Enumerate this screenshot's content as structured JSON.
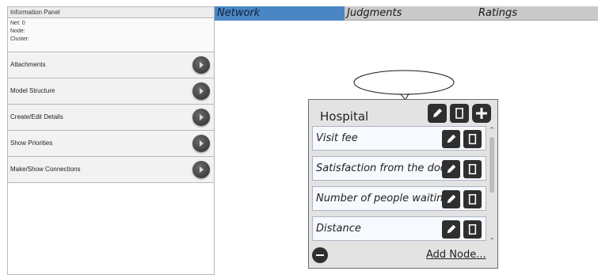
{
  "info_panel": {
    "title": "Information Panel",
    "net_line": "Net: 0",
    "node_line": "Node:",
    "cluster_line": "Cluster:",
    "buttons": [
      {
        "label": "Attachments",
        "icon": "chevron-right-icon"
      },
      {
        "label": "Model Structure",
        "icon": "chevron-right-icon"
      },
      {
        "label": "Create/Edit Details",
        "icon": "chevron-right-icon"
      },
      {
        "label": "Show Priorities",
        "icon": "chevron-right-icon"
      },
      {
        "label": "Make/Show Connections",
        "icon": "chevron-right-icon"
      }
    ]
  },
  "tabs": [
    {
      "label": "Network",
      "active": true
    },
    {
      "label": "Judgments",
      "active": false
    },
    {
      "label": "Ratings",
      "active": false
    }
  ],
  "cluster": {
    "title": "Hospital",
    "header_icons": [
      "pencil-icon",
      "trash-icon",
      "plus-icon"
    ],
    "nodes": [
      {
        "label": "Visit fee"
      },
      {
        "label": "Satisfaction from the doctor"
      },
      {
        "label": "Number of people waiting"
      },
      {
        "label": "Distance"
      }
    ],
    "add_node_label": "Add Node..."
  },
  "colors": {
    "active_tab": "#4a86c4",
    "tab_bar": "#c9c9c9",
    "cluster_bg": "#e3e3e3",
    "node_bg": "#f6f9fd",
    "icon_button": "#2f2f2f"
  }
}
